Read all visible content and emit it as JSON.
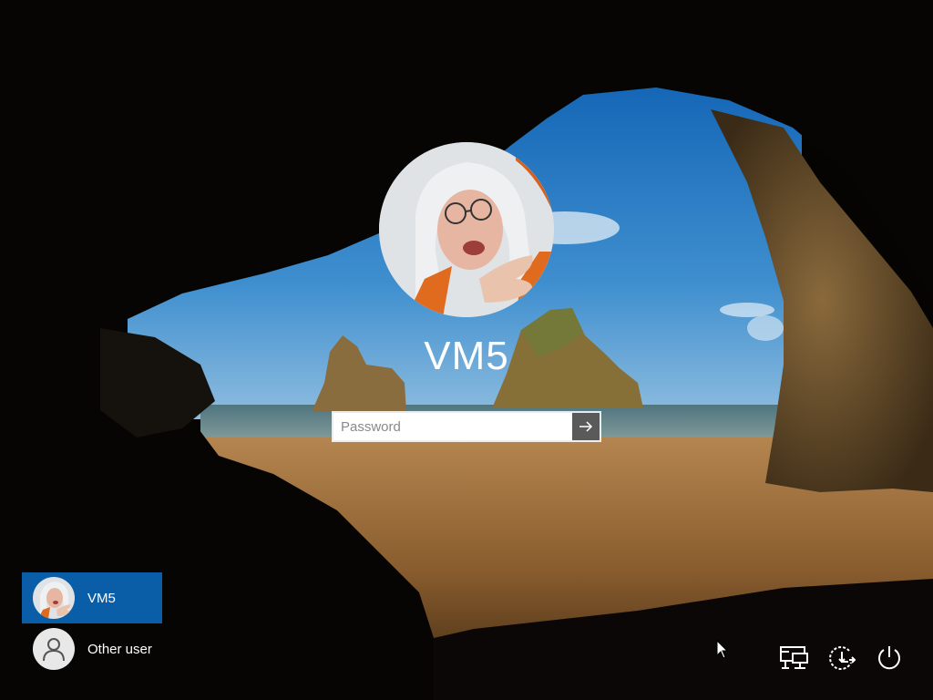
{
  "lock_screen": {
    "selected_user": "VM5",
    "password_placeholder": "Password"
  },
  "user_list": [
    {
      "label": "VM5",
      "selected": true
    },
    {
      "label": "Other user",
      "selected": false
    }
  ],
  "tray": {
    "icons": [
      "network-icon",
      "ease-of-access-icon",
      "power-icon"
    ]
  },
  "colors": {
    "selected_tile": "#0a5ea8",
    "submit_button": "#5a5a5a",
    "text": "#ffffff"
  }
}
